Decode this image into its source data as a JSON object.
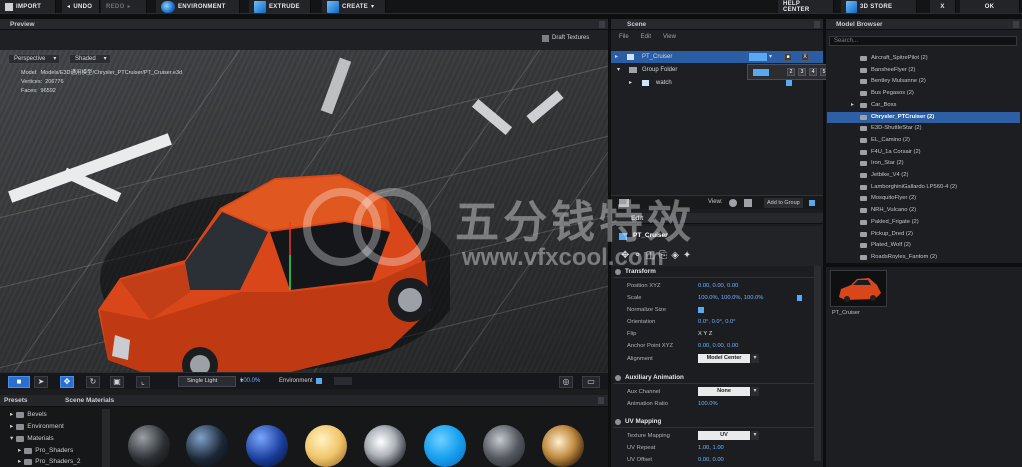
{
  "toolbar": {
    "import": "IMPORT",
    "undo": "UNDO",
    "redo": "REDO",
    "environment": "ENVIRONMENT",
    "extrude": "EXTRUDE",
    "create": "CREATE",
    "help_center": "HELP CENTER",
    "store": "3D STORE",
    "close": "X",
    "ok": "OK"
  },
  "preview": {
    "title": "Preview",
    "draft_textures": "Draft Textures",
    "view_mode": "Perspective",
    "shading_mode": "Shaded",
    "model_path": "Model:  Models/E3D通用模型/Chrysler_PTCruiser/PT_Cruiser.e3d",
    "vertices": "Vertices:  206776",
    "faces": "Faces:  96592"
  },
  "viewport_bar": {
    "light_mode": "Single Light",
    "light_value": "100.0%",
    "environment_label": "Environment"
  },
  "presets": {
    "tab_presets": "Presets",
    "tab_scene_materials": "Scene Materials",
    "tree": [
      "Bevels",
      "Environment",
      "Materials",
      "Pro_Shaders",
      "Pro_Shaders_2"
    ]
  },
  "scene": {
    "title": "Scene",
    "menu": [
      "File",
      "Edit",
      "View"
    ],
    "items": [
      {
        "name": "PT_Cruiser"
      },
      {
        "name": "Group Folder"
      },
      {
        "name": "watch"
      }
    ],
    "popup_numbers": [
      "2",
      "3",
      "4",
      "5"
    ],
    "view_label": "View:",
    "add_to_group": "Add to Group"
  },
  "edit": {
    "title": "Edit",
    "object_name": "PT_Cruiser",
    "transform": {
      "header": "Transform",
      "position_label": "Position XYZ",
      "position": "0.00,   0.00,   0.00",
      "scale_label": "Scale",
      "scale": "100.0%,   100.0%,   100.0%",
      "normalize_label": "Normalize Size",
      "orientation_label": "Orientation",
      "orientation": "0.0°,   0.0°,   0.0°",
      "flip_label": "Flip",
      "flip": "X   Y   Z",
      "anchor_label": "Anchor Point XYZ",
      "anchor": "0.00,   0.00,   0.00",
      "alignment_label": "Alignment",
      "alignment": "Model Center"
    },
    "aux": {
      "header": "Auxiliary Animation",
      "channel_label": "Aux Channel",
      "channel": "None",
      "ratio_label": "Animation Ratio",
      "ratio": "100.0%"
    },
    "uv": {
      "header": "UV Mapping",
      "texture_label": "Texture Mapping",
      "texture": "UV",
      "repeat_label": "UV Repeat",
      "repeat": "1.00,   1.00",
      "offset_label": "UV Offset",
      "offset": "0.00,   0.00"
    }
  },
  "browser": {
    "title": "Model Browser",
    "search_placeholder": "Search...",
    "items": [
      "Aircraft_SpitrePilot (2)",
      "BansheeFlyer (2)",
      "Bentley Mulsanne (2)",
      "Bus Pegasos (2)",
      "Car_Boss",
      "Chrysler_PTCruiser (2)",
      "E3D-ShuttleStar (2)",
      "EL_Camino (2)",
      "F4U_1a Corsair (2)",
      "Iron_Star (2)",
      "Jetbike_V4 (2)",
      "LamborghiniGallardo LP560-4 (2)",
      "MosquitoFlyer (2)",
      "NRH_Vulcano (2)",
      "Pakled_Frigate (2)",
      "Pickup_Dred (2)",
      "Plated_Wolf (2)",
      "RoadsRoyles_Fantom (2)"
    ],
    "selected_index": 5,
    "thumb_label": "PT_Cruiser"
  },
  "watermark": {
    "cn": "五分钱特效",
    "url": "www.vfxcool.com"
  }
}
